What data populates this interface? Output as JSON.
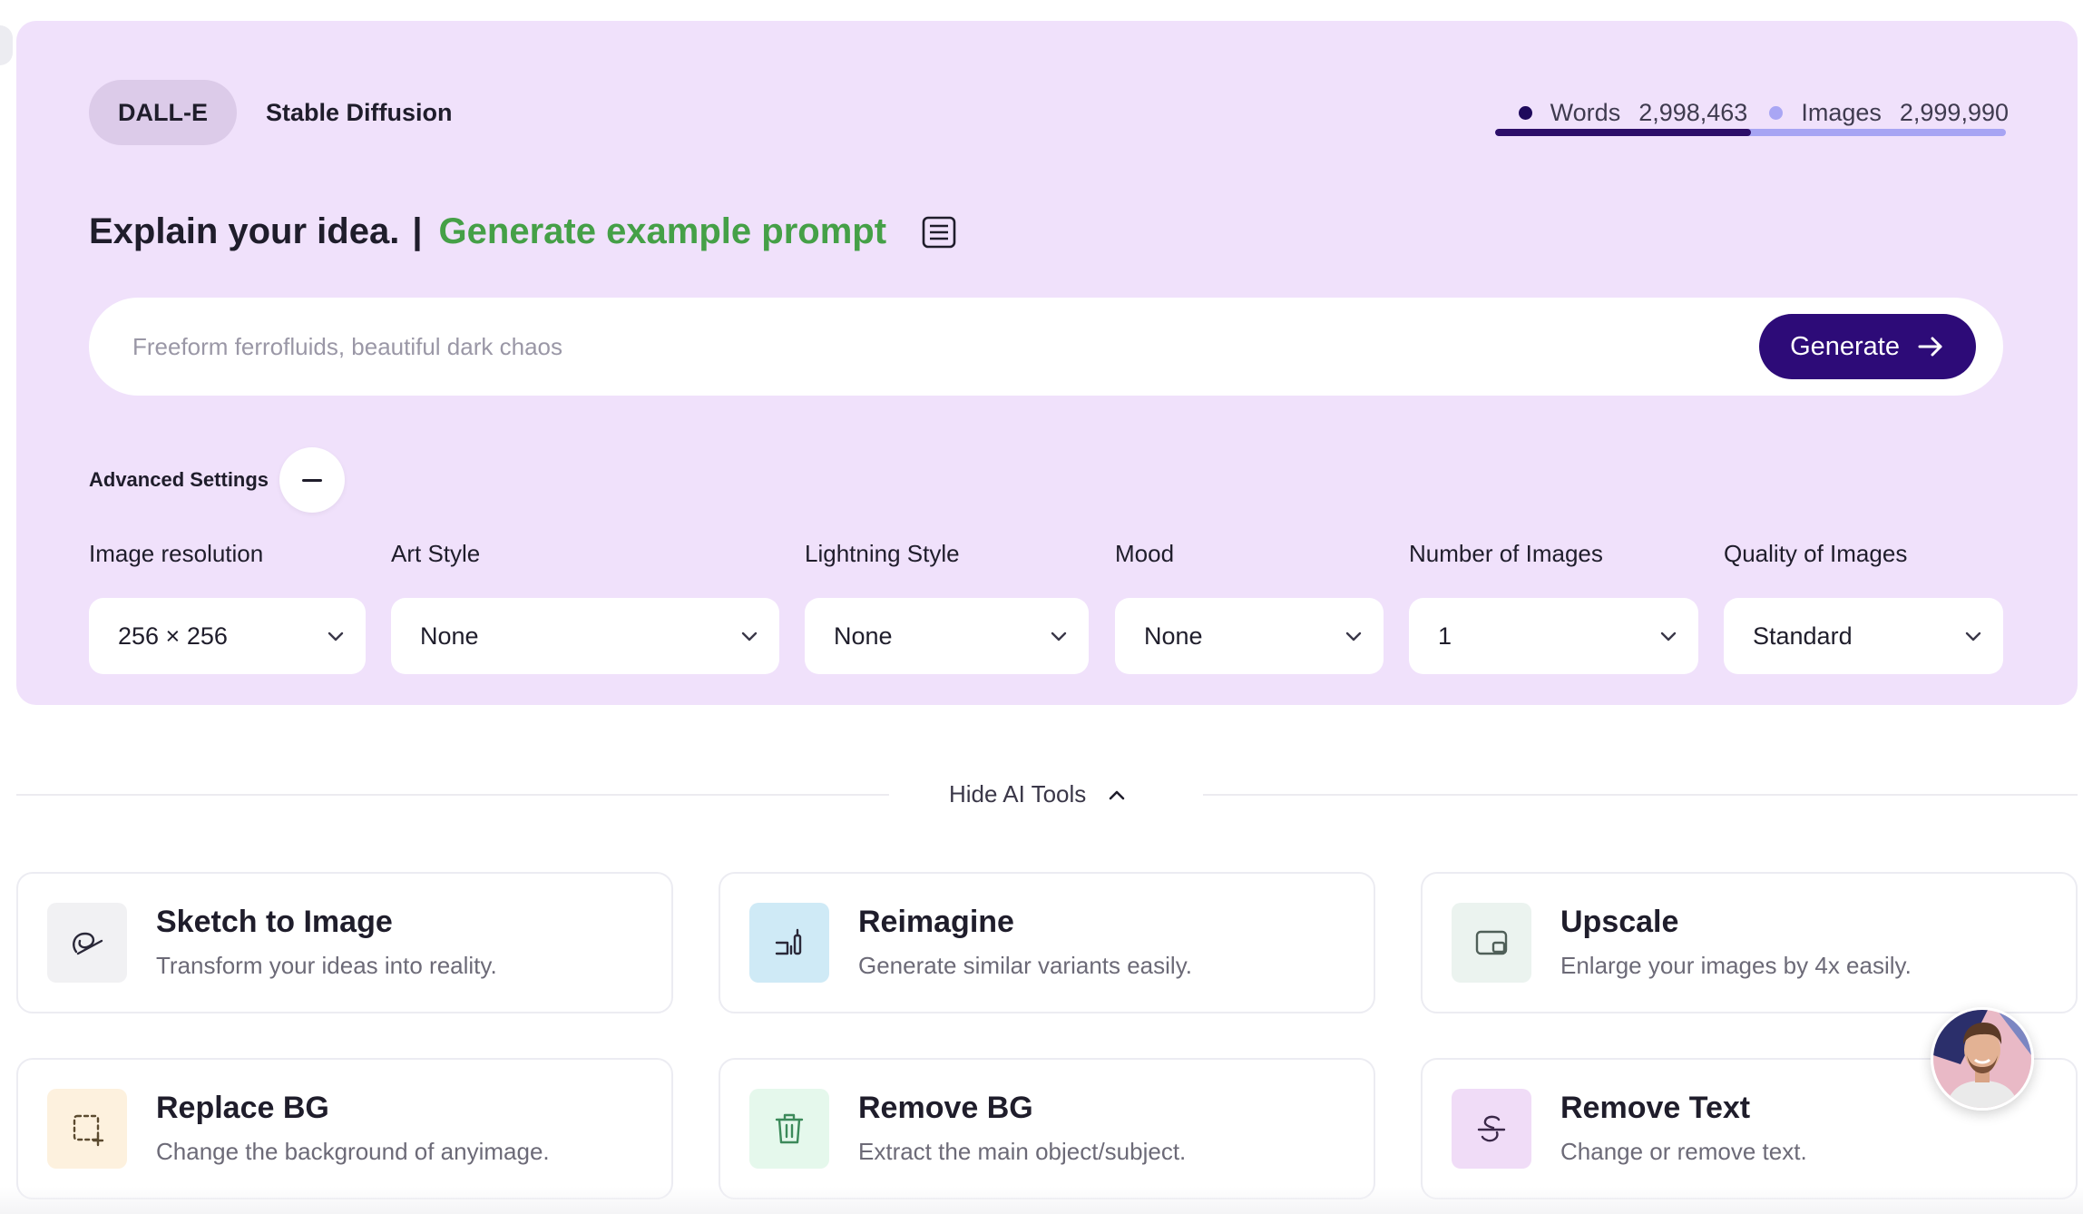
{
  "tabs": [
    {
      "label": "DALL-E",
      "active": true
    },
    {
      "label": "Stable Diffusion",
      "active": false
    }
  ],
  "usage": {
    "words_label": "Words",
    "words_value": "2,998,463",
    "words_color": "#1f0a5c",
    "images_label": "Images",
    "images_value": "2,999,990",
    "images_color": "#a9a6f4",
    "words_fraction": 0.5
  },
  "headline": {
    "title": "Explain your idea.",
    "separator": "|",
    "example_link": "Generate example prompt",
    "icon": "document-lines-icon"
  },
  "prompt": {
    "placeholder": "Freeform ferrofluids, beautiful dark chaos",
    "value": "",
    "generate_label": "Generate"
  },
  "advanced": {
    "label": "Advanced Settings",
    "toggle_icon": "minus-icon"
  },
  "settings": [
    {
      "label": "Image resolution",
      "value": "256 × 256"
    },
    {
      "label": "Art Style",
      "value": "None"
    },
    {
      "label": "Lightning Style",
      "value": "None"
    },
    {
      "label": "Mood",
      "value": "None"
    },
    {
      "label": "Number of Images",
      "value": "1"
    },
    {
      "label": "Quality of Images",
      "value": "Standard"
    }
  ],
  "tools_toggle": {
    "label": "Hide AI Tools",
    "icon": "chevron-up-icon"
  },
  "tools": [
    {
      "title": "Sketch to Image",
      "description": "Transform your ideas into reality.",
      "icon": "sketch-icon",
      "icon_bg": "#f1f1f3"
    },
    {
      "title": "Reimagine",
      "description": "Generate similar variants easily.",
      "icon": "brush-icon",
      "icon_bg": "#cfeaf6"
    },
    {
      "title": "Upscale",
      "description": "Enlarge your images by 4x easily.",
      "icon": "resize-icon",
      "icon_bg": "#ebf3ef"
    },
    {
      "title": "Replace BG",
      "description": "Change the background of anyimage.",
      "icon": "selection-add-icon",
      "icon_bg": "#fdf1de"
    },
    {
      "title": "Remove BG",
      "description": "Extract the main object/subject.",
      "icon": "trash-icon",
      "icon_bg": "#e5f8ec"
    },
    {
      "title": "Remove Text",
      "description": "Change or remove text.",
      "icon": "strikethrough-icon",
      "icon_bg": "#f0dcf7"
    }
  ],
  "colors": {
    "panel_bg": "#f0e1fb",
    "accent": "#2d0b78",
    "example_link": "#45a047"
  },
  "support_avatar": {
    "icon": "support-avatar"
  }
}
